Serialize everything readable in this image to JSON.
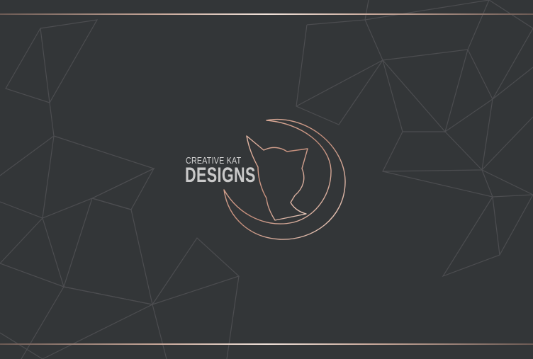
{
  "brand": {
    "line1": "CREATIVE KAT",
    "line2": "DESIGNS"
  },
  "colors": {
    "background": "#333638",
    "polygon_lines": "#4e4f52",
    "accent_rose_gold": "#d9a796"
  },
  "logo": {
    "icon": "cat-moon-logo-icon"
  }
}
